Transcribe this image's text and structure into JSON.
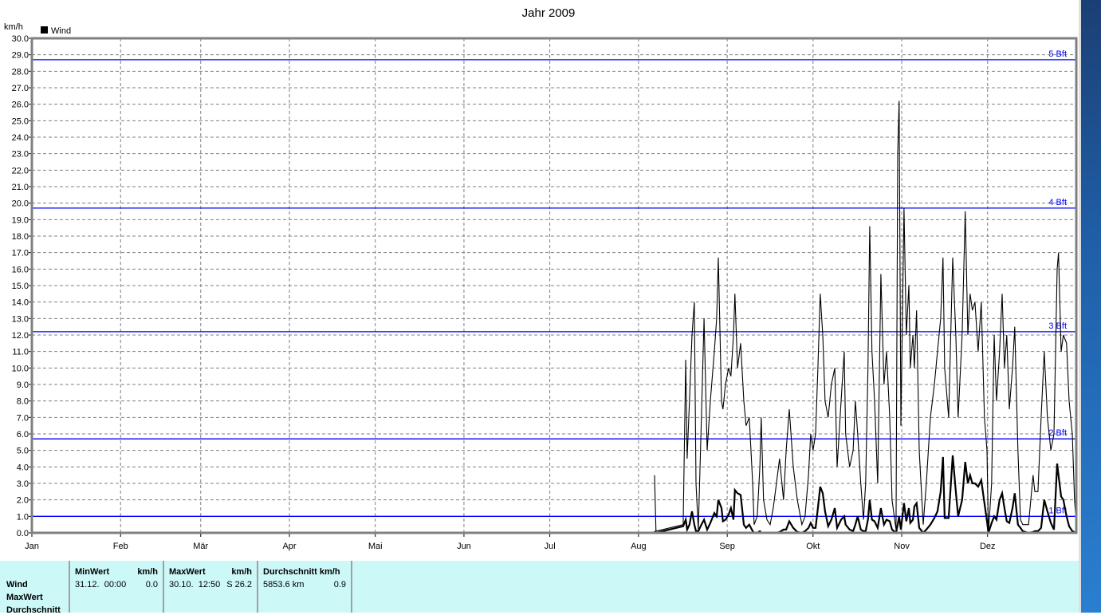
{
  "chart_data": {
    "type": "line",
    "title": "Jahr 2009",
    "ylabel": "km/h",
    "xlabel": "",
    "legend": {
      "label": "Wind",
      "placement": "top-left"
    },
    "ylim": [
      0,
      30
    ],
    "xlim_day_of_year": [
      1,
      366
    ],
    "y_ticks": [
      "0.0",
      "1.0",
      "2.0",
      "3.0",
      "4.0",
      "5.0",
      "6.0",
      "7.0",
      "8.0",
      "9.0",
      "10.0",
      "11.0",
      "12.0",
      "13.0",
      "14.0",
      "15.0",
      "16.0",
      "17.0",
      "18.0",
      "19.0",
      "20.0",
      "21.0",
      "22.0",
      "23.0",
      "24.0",
      "25.0",
      "26.0",
      "27.0",
      "28.0",
      "29.0",
      "30.0"
    ],
    "months": [
      {
        "label": "Jan",
        "day": 1
      },
      {
        "label": "Feb",
        "day": 32
      },
      {
        "label": "Mär",
        "day": 60
      },
      {
        "label": "Apr",
        "day": 91
      },
      {
        "label": "Mai",
        "day": 121
      },
      {
        "label": "Jun",
        "day": 152
      },
      {
        "label": "Jul",
        "day": 182
      },
      {
        "label": "Aug",
        "day": 213
      },
      {
        "label": "Sep",
        "day": 244
      },
      {
        "label": "Okt",
        "day": 274
      },
      {
        "label": "Nov",
        "day": 305
      },
      {
        "label": "Dez",
        "day": 335
      }
    ],
    "reference_lines": [
      {
        "label": "1 Bft",
        "value": 1.0
      },
      {
        "label": "2 Bft",
        "value": 5.7
      },
      {
        "label": "3 Bft",
        "value": 12.2
      },
      {
        "label": "4 Bft",
        "value": 19.7
      },
      {
        "label": "5 Bft",
        "value": 28.7
      }
    ],
    "grid": true,
    "colors": {
      "series": "#000000",
      "reference": "#0000ff",
      "grid": "#808080",
      "frame": "#808080"
    },
    "series_fields": [
      "day_of_year",
      "max_kmh",
      "avg_kmh"
    ],
    "series": [
      [
        218.6,
        3.5,
        0.1
      ],
      [
        219.1,
        0.1,
        0
      ],
      [
        228.6,
        0.5,
        0.4
      ],
      [
        229.5,
        10.5,
        0.8
      ],
      [
        230.0,
        4.5,
        0.2
      ],
      [
        230.8,
        8,
        0.5
      ],
      [
        231.7,
        12,
        1.3
      ],
      [
        232.5,
        14,
        0.5
      ],
      [
        233.1,
        3,
        0.1
      ],
      [
        233.9,
        0.2,
        0.1
      ],
      [
        235.0,
        7,
        0.5
      ],
      [
        235.9,
        13,
        0.8
      ],
      [
        237.0,
        5,
        0.2
      ],
      [
        238.1,
        8,
        0.6
      ],
      [
        239.5,
        11,
        1.2
      ],
      [
        240.3,
        13,
        1.0
      ],
      [
        240.9,
        16.7,
        2.0
      ],
      [
        242.0,
        8,
        1.5
      ],
      [
        242.5,
        7.5,
        0.7
      ],
      [
        243.4,
        9,
        0.8
      ],
      [
        244.5,
        10,
        1.1
      ],
      [
        245.3,
        9.5,
        1.5
      ],
      [
        246.2,
        12,
        0.8
      ],
      [
        246.7,
        14.5,
        2.6
      ],
      [
        247.6,
        10,
        2.4
      ],
      [
        248.7,
        11.5,
        2.3
      ],
      [
        249.8,
        8,
        0.5
      ],
      [
        250.6,
        6.5,
        0.3
      ],
      [
        251.7,
        7,
        0.5
      ],
      [
        252.9,
        3,
        0.1
      ],
      [
        253.4,
        0.5,
        0
      ],
      [
        254.5,
        1.0,
        0
      ],
      [
        255.4,
        4,
        0.1
      ],
      [
        255.9,
        7,
        0
      ],
      [
        256.7,
        2,
        0
      ],
      [
        257.9,
        0.8,
        0
      ],
      [
        259.0,
        0.5,
        0
      ],
      [
        260.1,
        1.5,
        0
      ],
      [
        261.2,
        3,
        0
      ],
      [
        262.3,
        4.5,
        0.05
      ],
      [
        263.7,
        2,
        0.2
      ],
      [
        264.6,
        5,
        0.2
      ],
      [
        265.7,
        7.5,
        0.7
      ],
      [
        267.1,
        4,
        0.3
      ],
      [
        268.5,
        2,
        0.05
      ],
      [
        270.1,
        0.5,
        0
      ],
      [
        271.2,
        1,
        0.1
      ],
      [
        272.4,
        3.5,
        0.3
      ],
      [
        273.2,
        6,
        0.6
      ],
      [
        274.0,
        5,
        0.3
      ],
      [
        274.9,
        6,
        0.3
      ],
      [
        275.7,
        10,
        1.5
      ],
      [
        276.5,
        14.5,
        2.8
      ],
      [
        277.4,
        12,
        2.4
      ],
      [
        278.2,
        8,
        1.3
      ],
      [
        279.3,
        7,
        0.4
      ],
      [
        280.4,
        9,
        0.8
      ],
      [
        281.6,
        10,
        1.5
      ],
      [
        282.4,
        4,
        0.3
      ],
      [
        283.8,
        8,
        0.8
      ],
      [
        284.9,
        11,
        1.0
      ],
      [
        285.4,
        6,
        0.5
      ],
      [
        286.8,
        4,
        0.2
      ],
      [
        288.0,
        5,
        0.1
      ],
      [
        288.8,
        8,
        0.5
      ],
      [
        289.6,
        6,
        1.0
      ],
      [
        290.7,
        3,
        0.2
      ],
      [
        291.6,
        0.8,
        0.1
      ],
      [
        292.4,
        3,
        0.1
      ],
      [
        293.2,
        10,
        0.8
      ],
      [
        293.8,
        18.6,
        2.0
      ],
      [
        294.6,
        11,
        0.8
      ],
      [
        295.5,
        8,
        0.7
      ],
      [
        296.6,
        3,
        0.3
      ],
      [
        297.7,
        15.7,
        1.5
      ],
      [
        298.8,
        9,
        0.5
      ],
      [
        299.7,
        11,
        0.8
      ],
      [
        300.8,
        7,
        0.7
      ],
      [
        301.6,
        2,
        0.2
      ],
      [
        303.0,
        0.2,
        0
      ],
      [
        303.6,
        23,
        0.5
      ],
      [
        304.1,
        26.2,
        1.0
      ],
      [
        304.7,
        6.5,
        0.2
      ],
      [
        305.8,
        19.7,
        1.8
      ],
      [
        306.6,
        12,
        0.7
      ],
      [
        307.5,
        15,
        1.5
      ],
      [
        308.0,
        10,
        0.6
      ],
      [
        308.9,
        12,
        0.8
      ],
      [
        309.4,
        10,
        1.6
      ],
      [
        310.2,
        13.5,
        1.8
      ],
      [
        311.1,
        5,
        0.3
      ],
      [
        312.5,
        0.5,
        0
      ],
      [
        313.6,
        3,
        0.2
      ],
      [
        315.0,
        7,
        0.5
      ],
      [
        316.4,
        9,
        0.9
      ],
      [
        317.5,
        11,
        1.3
      ],
      [
        318.6,
        13,
        2.5
      ],
      [
        319.4,
        16.7,
        4.6
      ],
      [
        320.0,
        10,
        0.9
      ],
      [
        321.4,
        7,
        0.9
      ],
      [
        322.8,
        16.7,
        4.7
      ],
      [
        323.9,
        12,
        2.5
      ],
      [
        324.7,
        7,
        1.0
      ],
      [
        326.1,
        12,
        2.0
      ],
      [
        327.2,
        19.5,
        4.3
      ],
      [
        328.1,
        12,
        3.0
      ],
      [
        328.9,
        14.5,
        3.5
      ],
      [
        329.7,
        13.5,
        3.0
      ],
      [
        330.6,
        14,
        3.0
      ],
      [
        331.7,
        11,
        2.8
      ],
      [
        332.8,
        14,
        3.2
      ],
      [
        333.9,
        7,
        1.8
      ],
      [
        334.8,
        5,
        0.7
      ],
      [
        335.3,
        0,
        0
      ],
      [
        336.4,
        3,
        0.6
      ],
      [
        337.3,
        12,
        1.0
      ],
      [
        338.1,
        8,
        0.8
      ],
      [
        339.2,
        11,
        2.0
      ],
      [
        340.1,
        14.5,
        2.4
      ],
      [
        340.9,
        10,
        1.5
      ],
      [
        341.7,
        12,
        0.7
      ],
      [
        342.6,
        7.5,
        0.6
      ],
      [
        343.7,
        10,
        1.5
      ],
      [
        344.5,
        12.5,
        2.4
      ],
      [
        345.6,
        5,
        0.5
      ],
      [
        346.5,
        0.8,
        0.3
      ],
      [
        347.3,
        0.5,
        0.1
      ],
      [
        349.3,
        0.5,
        0
      ],
      [
        350.9,
        3.5,
        0.05
      ],
      [
        351.5,
        2.5,
        0.1
      ],
      [
        352.6,
        2.5,
        0.1
      ],
      [
        353.7,
        7,
        0.3
      ],
      [
        354.8,
        11,
        2.0
      ],
      [
        355.9,
        7,
        1.3
      ],
      [
        357.1,
        5,
        0.6
      ],
      [
        358.2,
        6,
        0.2
      ],
      [
        359.3,
        16,
        4.2
      ],
      [
        359.8,
        17,
        3.5
      ],
      [
        360.7,
        11,
        2.2
      ],
      [
        361.5,
        12,
        2.0
      ],
      [
        362.6,
        11.5,
        1.0
      ],
      [
        363.5,
        8,
        0.4
      ],
      [
        364.6,
        6,
        0.1
      ],
      [
        365.4,
        2,
        0.05
      ],
      [
        366.0,
        0.5,
        0
      ]
    ]
  },
  "stats": {
    "row_labels": [
      "Wind",
      "MaxWert",
      "Durchschnitt"
    ],
    "min": {
      "header": "MinWert",
      "unit": "km/h",
      "date": "31.12.  00:00",
      "value": "0.0"
    },
    "max": {
      "header": "MaxWert",
      "unit": "km/h",
      "date": "30.10.  12:50",
      "value": "S 26.2"
    },
    "avg": {
      "header": "Durchschnitt km/h",
      "distance": "5853.6 km",
      "value": "0.9"
    }
  }
}
